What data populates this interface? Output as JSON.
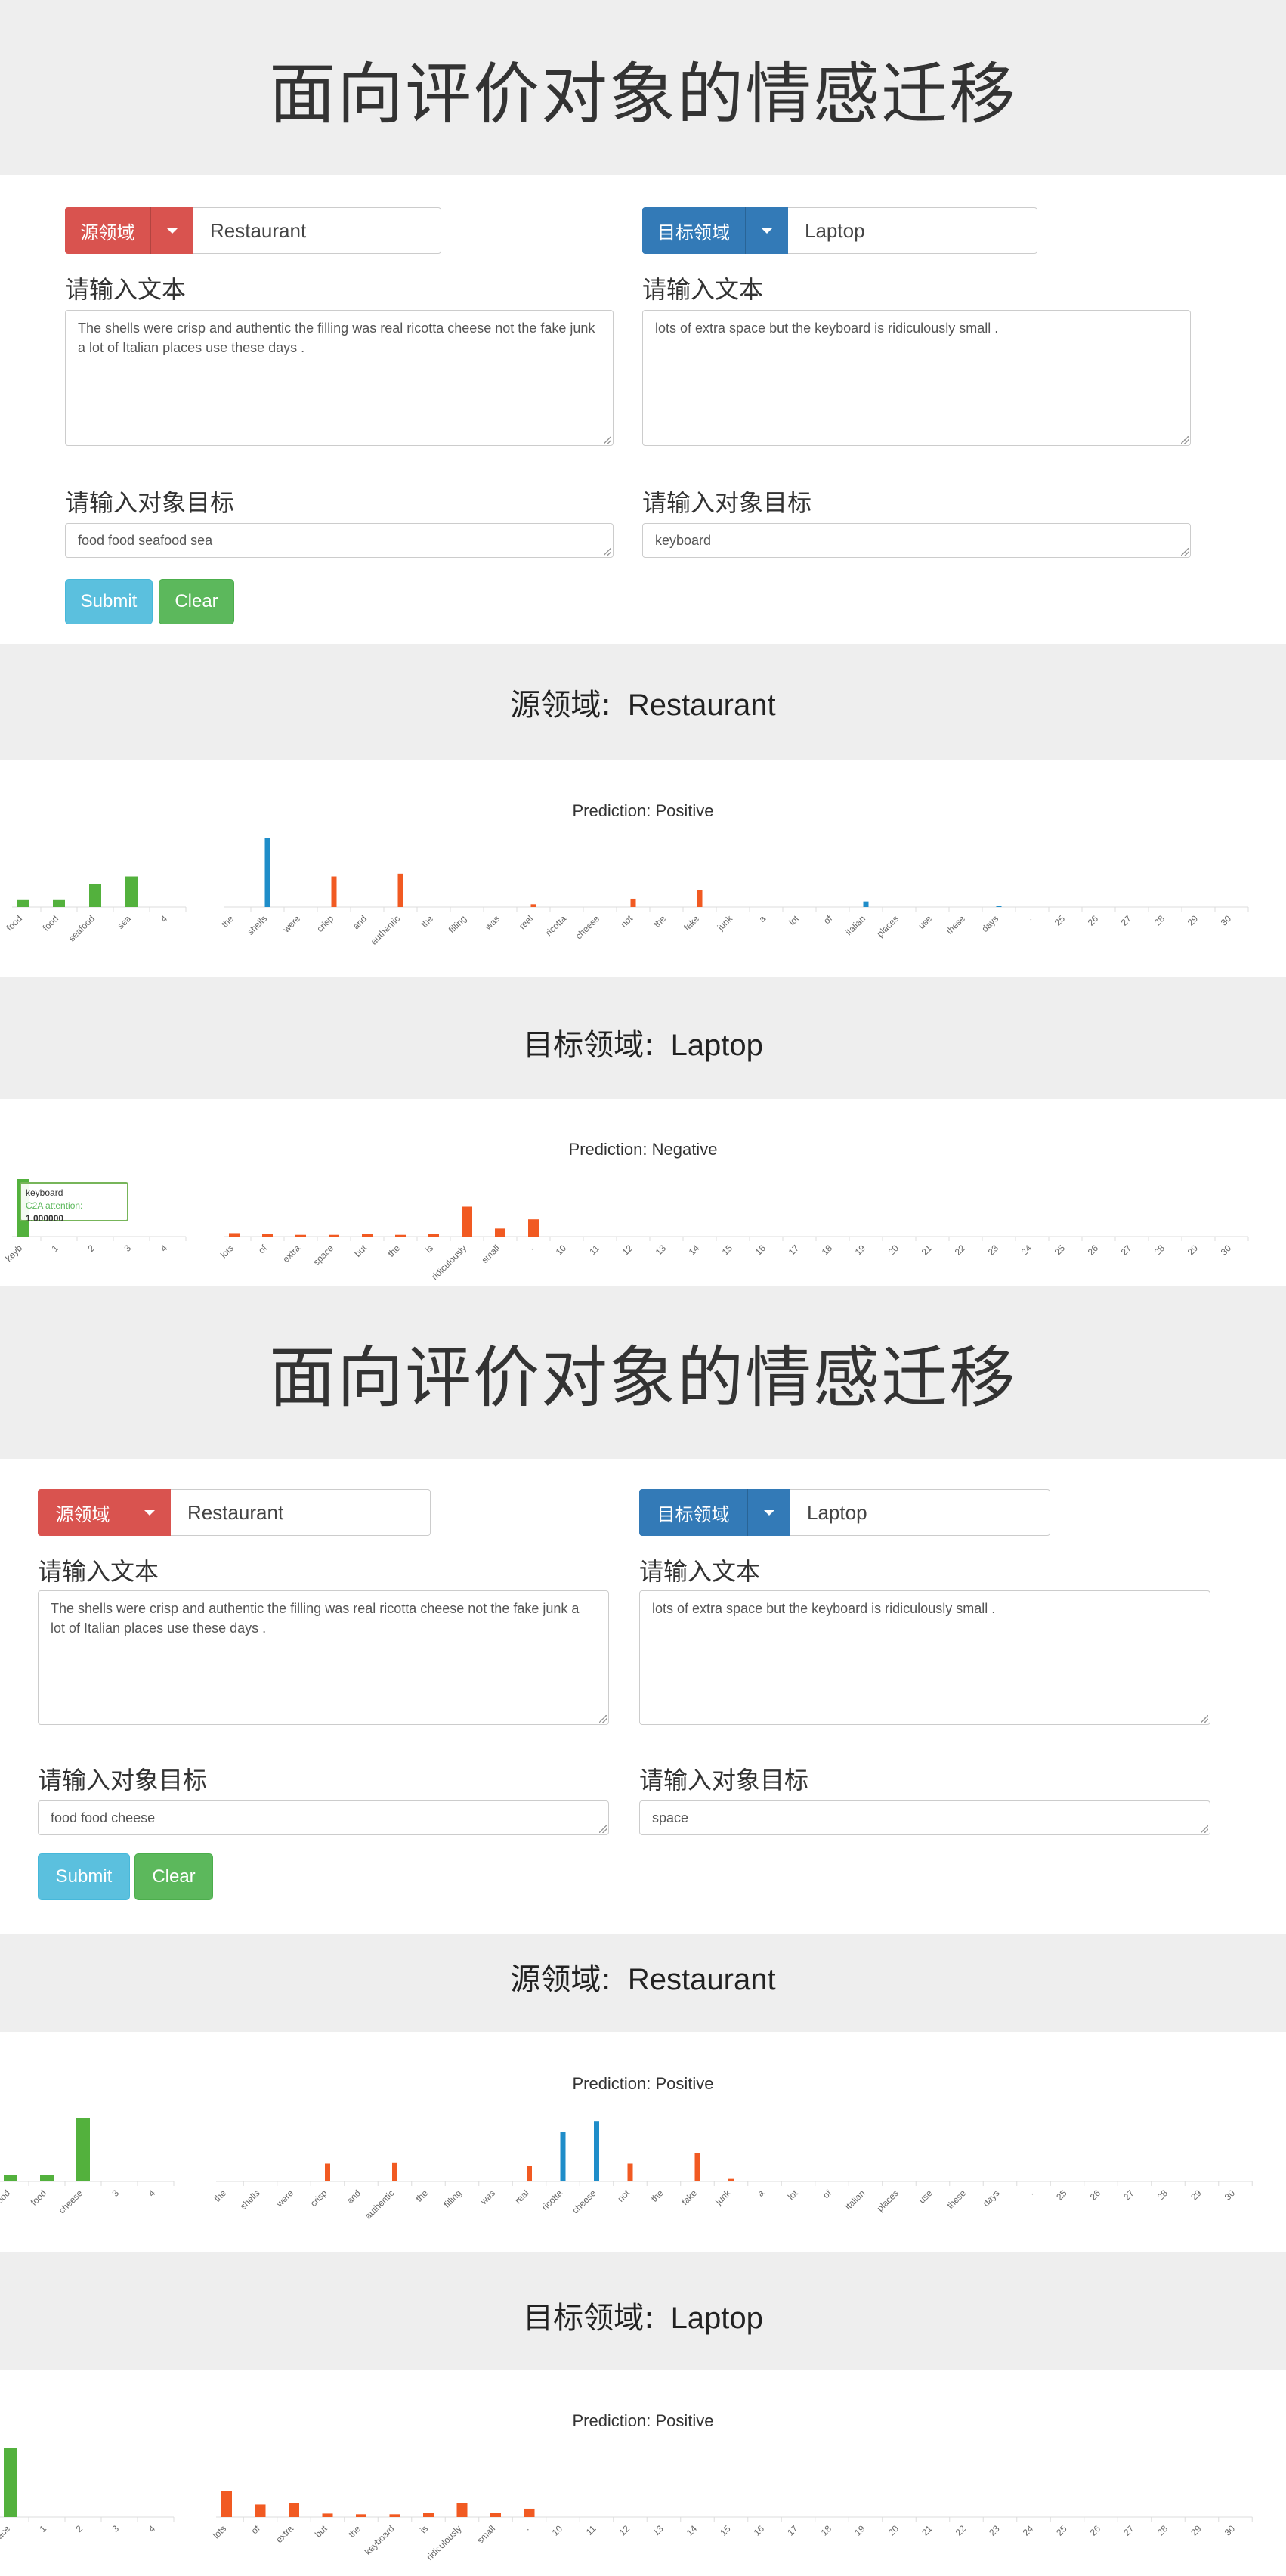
{
  "colors": {
    "source": "#d9534f",
    "target": "#337ab7",
    "submit": "#5bc0de",
    "clear": "#5cb85c",
    "bar_green": "#53b13d",
    "bar_orange": "#f15a22",
    "bar_blue": "#1f8dc9"
  },
  "panels": [
    {
      "title": "面向评价对象的情感迁移",
      "source": {
        "dropdown_label": "源领域",
        "domain": "Restaurant",
        "text_label": "请输入文本",
        "text": "The shells were crisp and authentic the filling was real ricotta cheese not the fake junk a lot of Italian places use these days .",
        "target_label": "请输入对象目标",
        "target": "food food seafood sea"
      },
      "target": {
        "dropdown_label": "目标领域",
        "domain": "Laptop",
        "text_label": "请输入文本",
        "text": "lots of extra space but the keyboard is ridiculously small .",
        "target_label": "请输入对象目标",
        "target": "keyboard"
      },
      "buttons": {
        "submit": "Submit",
        "clear": "Clear"
      },
      "results": [
        {
          "heading": "源领域:",
          "domain": "Restaurant",
          "prediction": "Prediction: Positive"
        },
        {
          "heading": "目标领域:",
          "domain": "Laptop",
          "prediction": "Prediction: Negative",
          "tooltip": {
            "word": "keyboard",
            "label": "C2A attention:",
            "value": "1.000000"
          }
        }
      ]
    },
    {
      "title": "面向评价对象的情感迁移",
      "source": {
        "dropdown_label": "源领域",
        "domain": "Restaurant",
        "text_label": "请输入文本",
        "text": "The shells were crisp and authentic the filling was real ricotta cheese not the fake junk a lot of Italian places use these days .",
        "target_label": "请输入对象目标",
        "target": "food food cheese"
      },
      "target": {
        "dropdown_label": "目标领域",
        "domain": "Laptop",
        "text_label": "请输入文本",
        "text": "lots of extra space but the keyboard is ridiculously small .",
        "target_label": "请输入对象目标",
        "target": "space"
      },
      "buttons": {
        "submit": "Submit",
        "clear": "Clear"
      },
      "results": [
        {
          "heading": "源领域:",
          "domain": "Restaurant",
          "prediction": "Prediction: Positive"
        },
        {
          "heading": "目标领域:",
          "domain": "Laptop",
          "prediction": "Prediction: Positive"
        }
      ]
    }
  ],
  "chart_data": [
    {
      "type": "bar",
      "title": "",
      "aspect_chart": {
        "categories": [
          "food",
          "food",
          "seafood",
          "sea",
          "4"
        ],
        "values": [
          0.1,
          0.1,
          0.33,
          0.44,
          0
        ],
        "color": "#53b13d"
      },
      "attention_chart": {
        "categories": [
          "the",
          "shells",
          "were",
          "crisp",
          "and",
          "authentic",
          "the",
          "filling",
          "was",
          "real",
          "ricotta",
          "cheese",
          "not",
          "the",
          "fake",
          "junk",
          "a",
          "lot",
          "of",
          "italian",
          "places",
          "use",
          "these",
          "days",
          ".",
          "25",
          "26",
          "27",
          "28",
          "29",
          "30"
        ],
        "values": [
          0,
          1.0,
          0,
          0.44,
          0,
          0.48,
          0,
          0,
          0,
          0.04,
          0,
          0,
          0.12,
          0,
          0.25,
          0,
          0,
          0,
          0,
          0.08,
          0,
          0,
          0,
          0.02,
          0,
          0,
          0,
          0,
          0,
          0,
          0
        ],
        "colors": [
          "#f15a22",
          "#1f8dc9",
          "#f15a22",
          "#f15a22",
          "#f15a22",
          "#f15a22",
          "#f15a22",
          "#f15a22",
          "#f15a22",
          "#f15a22",
          "#f15a22",
          "#f15a22",
          "#f15a22",
          "#f15a22",
          "#f15a22",
          "#f15a22",
          "#f15a22",
          "#f15a22",
          "#f15a22",
          "#1f8dc9",
          "#f15a22",
          "#f15a22",
          "#f15a22",
          "#1f8dc9",
          "#f15a22",
          "#f15a22",
          "#f15a22",
          "#f15a22",
          "#f15a22",
          "#f15a22",
          "#f15a22"
        ]
      }
    },
    {
      "type": "bar",
      "title": "",
      "aspect_chart": {
        "categories": [
          "keyb",
          "1",
          "2",
          "3",
          "4"
        ],
        "values": [
          1.0,
          0,
          0,
          0,
          0
        ],
        "color": "#53b13d"
      },
      "attention_chart": {
        "categories": [
          "lots",
          "of",
          "extra",
          "space",
          "but",
          "the",
          "is",
          "ridiculously",
          "small",
          ".",
          "10",
          "11",
          "12",
          "13",
          "14",
          "15",
          "16",
          "17",
          "18",
          "19",
          "20",
          "21",
          "22",
          "23",
          "24",
          "25",
          "26",
          "27",
          "28",
          "29",
          "30"
        ],
        "values": [
          0.06,
          0.04,
          0.03,
          0.03,
          0.04,
          0.03,
          0.05,
          0.52,
          0.14,
          0.3,
          0,
          0,
          0,
          0,
          0,
          0,
          0,
          0,
          0,
          0,
          0,
          0,
          0,
          0,
          0,
          0,
          0,
          0,
          0,
          0,
          0
        ],
        "colors": [
          "#f15a22",
          "#f15a22",
          "#f15a22",
          "#f15a22",
          "#f15a22",
          "#f15a22",
          "#f15a22",
          "#f15a22",
          "#f15a22",
          "#f15a22",
          "#f15a22",
          "#f15a22",
          "#f15a22",
          "#f15a22",
          "#f15a22",
          "#f15a22",
          "#f15a22",
          "#f15a22",
          "#f15a22",
          "#f15a22",
          "#f15a22",
          "#f15a22",
          "#f15a22",
          "#f15a22",
          "#f15a22",
          "#f15a22",
          "#f15a22",
          "#f15a22",
          "#f15a22",
          "#f15a22",
          "#f15a22"
        ]
      }
    },
    {
      "type": "bar",
      "title": "",
      "aspect_chart": {
        "categories": [
          "food",
          "food",
          "cheese",
          "3",
          "4"
        ],
        "values": [
          0.1,
          0.1,
          1.0,
          0,
          0
        ],
        "color": "#53b13d"
      },
      "attention_chart": {
        "categories": [
          "the",
          "shells",
          "were",
          "crisp",
          "and",
          "authentic",
          "the",
          "filling",
          "was",
          "real",
          "ricotta",
          "cheese",
          "not",
          "the",
          "fake",
          "junk",
          "a",
          "lot",
          "of",
          "italian",
          "places",
          "use",
          "these",
          "days",
          ".",
          "25",
          "26",
          "27",
          "28",
          "29",
          "30"
        ],
        "values": [
          0,
          0,
          0,
          0.28,
          0,
          0.3,
          0,
          0,
          0,
          0.25,
          0.78,
          0.95,
          0.28,
          0,
          0.45,
          0.04,
          0,
          0,
          0,
          0,
          0,
          0,
          0,
          0,
          0,
          0,
          0,
          0,
          0,
          0,
          0
        ],
        "colors": [
          "#f15a22",
          "#f15a22",
          "#f15a22",
          "#f15a22",
          "#f15a22",
          "#f15a22",
          "#f15a22",
          "#f15a22",
          "#f15a22",
          "#f15a22",
          "#1f8dc9",
          "#1f8dc9",
          "#f15a22",
          "#f15a22",
          "#f15a22",
          "#f15a22",
          "#f15a22",
          "#f15a22",
          "#f15a22",
          "#f15a22",
          "#f15a22",
          "#f15a22",
          "#f15a22",
          "#f15a22",
          "#f15a22",
          "#f15a22",
          "#f15a22",
          "#f15a22",
          "#f15a22",
          "#f15a22",
          "#f15a22"
        ]
      }
    },
    {
      "type": "bar",
      "title": "",
      "aspect_chart": {
        "categories": [
          "space",
          "1",
          "2",
          "3",
          "4"
        ],
        "values": [
          1.0,
          0,
          0,
          0,
          0
        ],
        "color": "#53b13d"
      },
      "attention_chart": {
        "categories": [
          "lots",
          "of",
          "extra",
          "but",
          "the",
          "keyboard",
          "is",
          "ridiculously",
          "small",
          ".",
          "10",
          "11",
          "12",
          "13",
          "14",
          "15",
          "16",
          "17",
          "18",
          "19",
          "20",
          "21",
          "22",
          "23",
          "24",
          "25",
          "26",
          "27",
          "28",
          "29",
          "30"
        ],
        "values": [
          0.38,
          0.18,
          0.2,
          0.05,
          0.04,
          0.04,
          0.06,
          0.2,
          0.06,
          0.12,
          0,
          0,
          0,
          0,
          0,
          0,
          0,
          0,
          0,
          0,
          0,
          0,
          0,
          0,
          0,
          0,
          0,
          0,
          0,
          0,
          0
        ],
        "colors": [
          "#f15a22",
          "#f15a22",
          "#f15a22",
          "#f15a22",
          "#f15a22",
          "#f15a22",
          "#f15a22",
          "#f15a22",
          "#f15a22",
          "#f15a22",
          "#f15a22",
          "#f15a22",
          "#f15a22",
          "#f15a22",
          "#f15a22",
          "#f15a22",
          "#f15a22",
          "#f15a22",
          "#f15a22",
          "#f15a22",
          "#f15a22",
          "#f15a22",
          "#f15a22",
          "#f15a22",
          "#f15a22",
          "#f15a22",
          "#f15a22",
          "#f15a22",
          "#f15a22",
          "#f15a22",
          "#f15a22"
        ]
      }
    }
  ]
}
